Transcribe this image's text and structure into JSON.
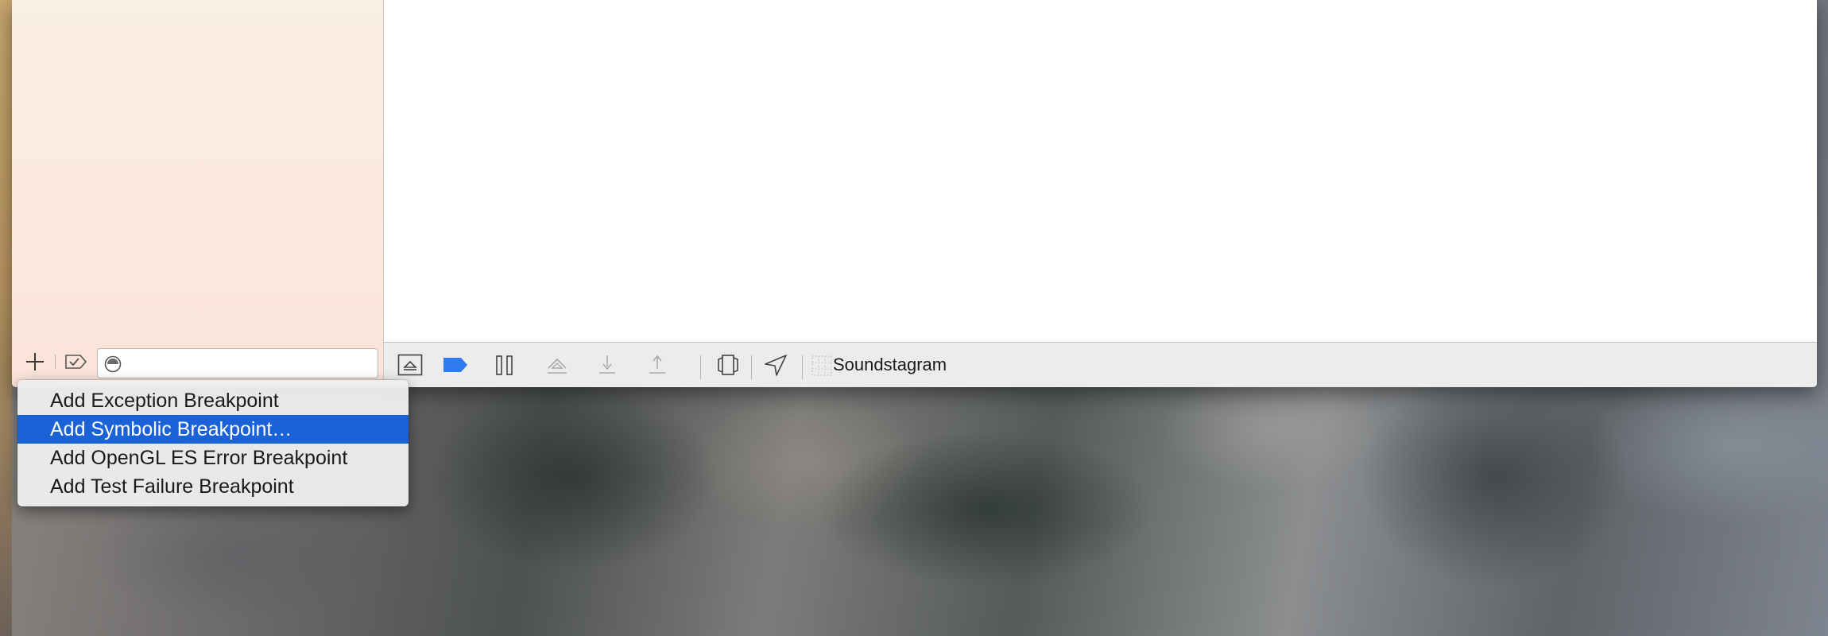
{
  "desktop": {
    "wallpaper": "rock-cliffs"
  },
  "debug_bar": {
    "target_name": "Soundstagram",
    "icons": [
      "hide-debug-area-icon",
      "breakpoints-toggle-icon",
      "pause-icon",
      "step-over-icon",
      "step-into-icon",
      "step-out-icon",
      "view-hierarchy-icon",
      "simulate-location-icon",
      "app-target-icon"
    ],
    "accent_color": "#2e7bf0"
  },
  "navigator_footer": {
    "icons": [
      "add-icon",
      "show-only-enabled-icon",
      "filter-icon"
    ]
  },
  "breakpoint_menu": {
    "items": [
      {
        "label": "Add Exception Breakpoint"
      },
      {
        "label": "Add Symbolic Breakpoint…"
      },
      {
        "label": "Add OpenGL ES Error Breakpoint"
      },
      {
        "label": "Add Test Failure Breakpoint"
      }
    ],
    "selected_index": 1,
    "highlight_color": "#1a62d6"
  }
}
